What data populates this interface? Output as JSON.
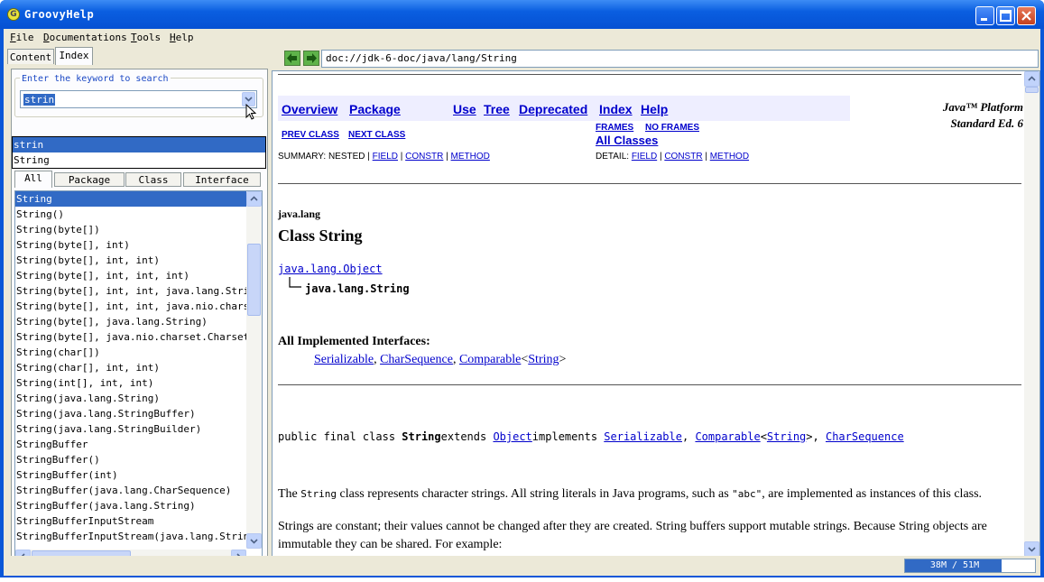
{
  "window": {
    "title": "GroovyHelp",
    "icon": "groovy-logo-icon"
  },
  "menu": [
    "File",
    "Documentations",
    "Tools",
    "Help"
  ],
  "left_tabs": [
    "Content",
    "Index"
  ],
  "search": {
    "label": "Enter the keyword to search",
    "value": "strin",
    "suggestions": [
      "strin",
      "String"
    ]
  },
  "filter_tabs": [
    "All",
    "Package",
    "Class",
    "Interface"
  ],
  "index_list": [
    "String",
    "String()",
    "String(byte[])",
    "String(byte[], int)",
    "String(byte[], int, int)",
    "String(byte[], int, int, int)",
    "String(byte[], int, int, java.lang.String)",
    "String(byte[], int, int, java.nio.charset.Charset)",
    "String(byte[], java.lang.String)",
    "String(byte[], java.nio.charset.Charset)",
    "String(char[])",
    "String(char[], int, int)",
    "String(int[], int, int)",
    "String(java.lang.String)",
    "String(java.lang.StringBuffer)",
    "String(java.lang.StringBuilder)",
    "StringBuffer",
    "StringBuffer()",
    "StringBuffer(int)",
    "StringBuffer(java.lang.CharSequence)",
    "StringBuffer(java.lang.String)",
    "StringBufferInputStream",
    "StringBufferInputStream(java.lang.String)"
  ],
  "selected_index": 0,
  "address": "doc://jdk-6-doc/java/lang/String",
  "doc": {
    "nav": [
      "Overview",
      "Package",
      "Use",
      "Tree",
      "Deprecated",
      "Index",
      "Help"
    ],
    "platform_line1": "Java™ Platform",
    "platform_line2": "Standard Ed. 6",
    "prev_class": "PREV CLASS",
    "next_class": "NEXT CLASS",
    "frames": "FRAMES",
    "no_frames": "NO FRAMES",
    "all_classes": "All Classes",
    "summary_label": "SUMMARY: NESTED | ",
    "summary_links": [
      "FIELD",
      "CONSTR",
      "METHOD"
    ],
    "detail_label": "DETAIL: ",
    "detail_links": [
      "FIELD",
      "CONSTR",
      "METHOD"
    ],
    "package": "java.lang",
    "class_title": "Class String",
    "superclass": "java.lang.Object",
    "this_class": "java.lang.String",
    "interfaces_heading": "All Implemented Interfaces:",
    "interfaces": [
      "Serializable",
      "CharSequence",
      "Comparable",
      "String"
    ],
    "decl_prefix": "public final class ",
    "decl_name": "String",
    "decl_extends": "extends ",
    "decl_object": "Object",
    "decl_implements": "implements ",
    "decl_ifaces": [
      "Serializable",
      "Comparable",
      "String",
      "CharSequence"
    ],
    "para1_a": "The ",
    "para1_code": "String",
    "para1_b": " class represents character strings. All string literals in Java programs, such as ",
    "para1_code2": "\"abc\"",
    "para1_c": ", are implemented as instances of this class.",
    "para2": "Strings are constant; their values cannot be changed after they are created. String buffers support mutable strings. Because String objects are immutable they can be shared. For example:"
  },
  "status": {
    "memory": "38M / 51M",
    "memory_used_fraction": 0.745
  }
}
